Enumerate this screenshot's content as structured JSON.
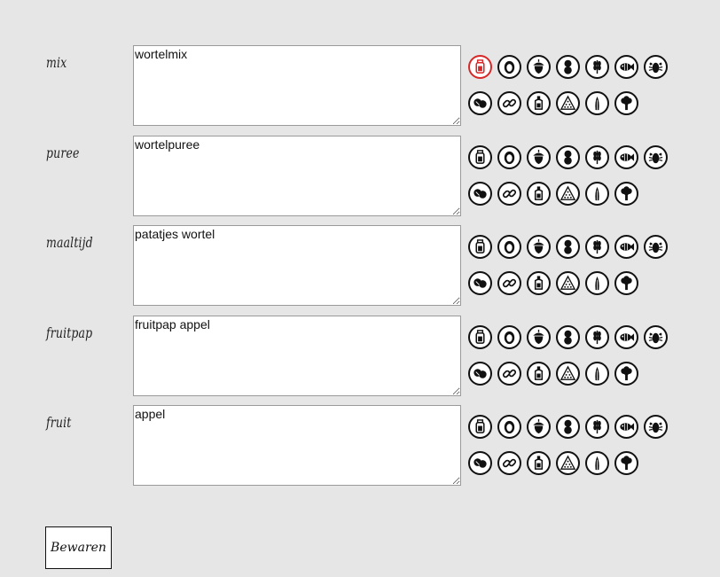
{
  "rows": [
    {
      "label": "mix",
      "value": "wortelmix",
      "active_icon": "bottle-icon"
    },
    {
      "label": "puree",
      "value": "wortelpuree",
      "active_icon": ""
    },
    {
      "label": "maaltijd",
      "value": "patatjes wortel",
      "active_icon": ""
    },
    {
      "label": "fruitpap",
      "value": "fruitpap appel",
      "active_icon": ""
    },
    {
      "label": "fruit",
      "value": "appel",
      "active_icon": ""
    }
  ],
  "allergen_icons": [
    [
      "bottle-icon",
      "egg-icon",
      "nut-icon",
      "peanut-icon",
      "wheat-icon",
      "fish-icon",
      "shellfish-icon"
    ],
    [
      "soy-icon",
      "chain-icon",
      "mustard-icon",
      "sesame-icon",
      "celery-icon",
      "broccoli-icon"
    ]
  ],
  "colors": {
    "active": "#d62828",
    "stroke": "#111111",
    "background": "#e6e6e6"
  },
  "save_button": {
    "label": "Bewaren"
  }
}
